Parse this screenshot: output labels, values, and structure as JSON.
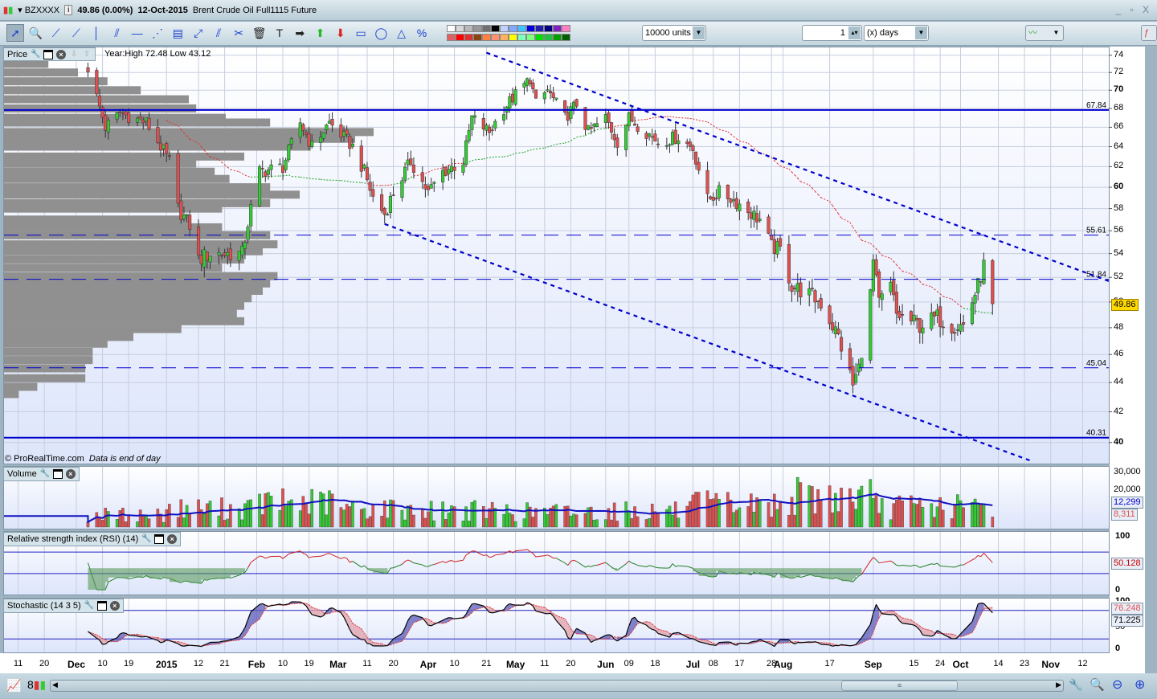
{
  "window": {
    "symbol": "BZXXXX",
    "quote": "49.86 (0.00%)",
    "date": "12-Oct-2015",
    "instrument": "Brent Crude Oil Full1115 Future",
    "controls": "_ ▫ X"
  },
  "toolbar": {
    "units": "10000 units",
    "period_value": "1",
    "period_unit": "(x) days",
    "tools": [
      "pointer-icon",
      "zoom-icon",
      "segment-icon",
      "line-icon",
      "vertical-line-icon",
      "channel-icon",
      "horizontal-line-icon",
      "fan-icon",
      "fibonacci-icon",
      "point-icon",
      "parallel-lines-icon",
      "tools-icon",
      "trash-icon",
      "text-icon",
      "arrow-right-icon",
      "arrow-up-icon",
      "arrow-down-icon",
      "rectangle-icon",
      "ellipse-icon",
      "triangle-icon",
      "percent-icon"
    ],
    "tool_glyphs": [
      "➚",
      "🔍",
      "⟋",
      "⟋",
      "│",
      "⫽",
      "—",
      "⋰",
      "▤",
      "⤢",
      "⫽",
      "✂",
      "🗑",
      "T",
      "➡",
      "⬆",
      "⬇",
      "▭",
      "◯",
      "△",
      "%"
    ],
    "palette_top": [
      "#ffffff",
      "#d8d8d8",
      "#b8b8b8",
      "#989898",
      "#707070",
      "#000000",
      "#c0d0ff",
      "#80a8ff",
      "#40c0ff",
      "#0000e0",
      "#2020b0",
      "#000080",
      "#8020c0",
      "#ff80c0"
    ],
    "palette_bottom": [
      "#e06060",
      "#ff0000",
      "#e03030",
      "#8b4513",
      "#ff8040",
      "#ff9070",
      "#ffb060",
      "#ffff00",
      "#80ffc0",
      "#80ff80",
      "#00e000",
      "#20c040",
      "#00a000",
      "#006000"
    ]
  },
  "price_panel": {
    "label": "Price",
    "year_range": "Year:High 72.48 Low 43.12",
    "copyright": "© ProRealTime.com",
    "data_note": "Data is end of day",
    "last_price": "49.86"
  },
  "volume_panel": {
    "label": "Volume",
    "ma_value": "12,299",
    "last_value": "8,311"
  },
  "rsi_panel": {
    "label": "Relative strength index (RSI) (14)",
    "value": "50.128"
  },
  "stoch_panel": {
    "label": "Stochastic (14 3 5)",
    "d_value": "76.248",
    "k_value": "71.225"
  },
  "colors": {
    "up": "#33cc33",
    "down": "#e05050",
    "level": "#0000cc",
    "ma_above": "#e03030",
    "ma_below": "#20a020",
    "last_price_bg": "#ffd800"
  },
  "chart_data": {
    "type": "candlestick",
    "title": "Brent Crude Oil Full1115 Future",
    "scale": "log",
    "ylim": [
      39,
      75
    ],
    "price_ticks": [
      40,
      42,
      44,
      46,
      48,
      50,
      52,
      54,
      56,
      58,
      60,
      62,
      64,
      66,
      68,
      70,
      72,
      74
    ],
    "bold_ticks": [
      40,
      60,
      70
    ],
    "key_closes": [
      [
        "2014-12-05",
        72.5
      ],
      [
        "2014-12-11",
        66
      ],
      [
        "2014-12-16",
        67.5
      ],
      [
        "2014-12-25",
        66.5
      ],
      [
        "2015-01-02",
        62.5
      ],
      [
        "2015-01-05",
        58
      ],
      [
        "2015-01-09",
        56.5
      ],
      [
        "2015-01-12",
        53.5
      ],
      [
        "2015-01-16",
        54
      ],
      [
        "2015-01-27",
        54
      ],
      [
        "2015-01-30",
        58
      ],
      [
        "2015-02-02",
        61.5
      ],
      [
        "2015-02-10",
        62
      ],
      [
        "2015-02-16",
        66.5
      ],
      [
        "2015-02-20",
        64
      ],
      [
        "2015-02-26",
        66.5
      ],
      [
        "2015-03-06",
        64
      ],
      [
        "2015-03-10",
        61.5
      ],
      [
        "2015-03-13",
        59
      ],
      [
        "2015-03-17",
        57.5
      ],
      [
        "2015-03-20",
        59.5
      ],
      [
        "2015-03-26",
        62.5
      ],
      [
        "2015-04-01",
        59.5
      ],
      [
        "2015-04-06",
        61.5
      ],
      [
        "2015-04-13",
        62.5
      ],
      [
        "2015-04-16",
        67
      ],
      [
        "2015-04-22",
        65.5
      ],
      [
        "2015-04-27",
        68
      ],
      [
        "2015-05-01",
        69.5
      ],
      [
        "2015-05-06",
        71.3
      ],
      [
        "2015-05-08",
        68.5
      ],
      [
        "2015-05-12",
        70
      ],
      [
        "2015-05-18",
        67
      ],
      [
        "2015-05-22",
        68.5
      ],
      [
        "2015-05-26",
        65.5
      ],
      [
        "2015-06-01",
        67
      ],
      [
        "2015-06-05",
        64.5
      ],
      [
        "2015-06-09",
        67
      ],
      [
        "2015-06-15",
        65.5
      ],
      [
        "2015-06-19",
        64.5
      ],
      [
        "2015-06-26",
        65
      ],
      [
        "2015-07-01",
        63.8
      ],
      [
        "2015-07-06",
        58.8
      ],
      [
        "2015-07-10",
        59.5
      ],
      [
        "2015-07-14",
        59
      ],
      [
        "2015-07-17",
        58.4
      ],
      [
        "2015-07-24",
        57
      ],
      [
        "2015-07-28",
        54.6
      ],
      [
        "2015-07-31",
        54.3
      ],
      [
        "2015-08-04",
        51.3
      ],
      [
        "2015-08-10",
        50.6
      ],
      [
        "2015-08-14",
        49.9
      ],
      [
        "2015-08-20",
        47.3
      ],
      [
        "2015-08-25",
        43.8
      ],
      [
        "2015-08-27",
        45
      ],
      [
        "2015-08-31",
        50.6
      ],
      [
        "2015-09-01",
        53.3
      ],
      [
        "2015-09-03",
        49.9
      ],
      [
        "2015-09-07",
        51.3
      ],
      [
        "2015-09-09",
        49
      ],
      [
        "2015-09-14",
        48.5
      ],
      [
        "2015-09-17",
        48.2
      ],
      [
        "2015-09-23",
        48.8
      ],
      [
        "2015-09-28",
        48.2
      ],
      [
        "2015-10-02",
        48.2
      ],
      [
        "2015-10-07",
        51.3
      ],
      [
        "2015-10-09",
        53
      ],
      [
        "2015-10-12",
        49.86
      ]
    ],
    "levels": [
      {
        "value": 67.84,
        "label": "67.84",
        "style": "solid"
      },
      {
        "value": 55.61,
        "label": "55.61",
        "style": "dashed"
      },
      {
        "value": 51.84,
        "label": "51.84",
        "style": "dashed"
      },
      {
        "value": 45.04,
        "label": "45.04",
        "style": "dashed"
      },
      {
        "value": 40.31,
        "label": "40.31",
        "style": "solid"
      }
    ],
    "trendlines": [
      {
        "from": [
          "2015-04-21",
          74.3
        ],
        "to": [
          "2015-11-22",
          51.6
        ]
      },
      {
        "from": [
          "2015-03-17",
          56.6
        ],
        "to": [
          "2015-10-26",
          38.8
        ]
      }
    ],
    "moving_average_period": 50,
    "volume_profile": [
      [
        74,
        0.05
      ],
      [
        73,
        0.12
      ],
      [
        72,
        0.2
      ],
      [
        71,
        0.28
      ],
      [
        70,
        0.37
      ],
      [
        69,
        0.5
      ],
      [
        68,
        0.52
      ],
      [
        67,
        0.6
      ],
      [
        66.5,
        0.72
      ],
      [
        65.5,
        1.0
      ],
      [
        64.8,
        0.95
      ],
      [
        64,
        0.83
      ],
      [
        63,
        0.65
      ],
      [
        62.3,
        0.52
      ],
      [
        61.5,
        0.57
      ],
      [
        60.8,
        0.61
      ],
      [
        60,
        0.72
      ],
      [
        59.3,
        0.8
      ],
      [
        58.5,
        0.72
      ],
      [
        58,
        0.59
      ],
      [
        57,
        0.5
      ],
      [
        56.3,
        0.59
      ],
      [
        55.6,
        0.72
      ],
      [
        54.8,
        0.74
      ],
      [
        54.2,
        0.7
      ],
      [
        53.5,
        0.65
      ],
      [
        52.8,
        0.59
      ],
      [
        52.1,
        0.74
      ],
      [
        51.5,
        0.72
      ],
      [
        50.9,
        0.7
      ],
      [
        50.3,
        0.67
      ],
      [
        49.7,
        0.65
      ],
      [
        49.1,
        0.63
      ],
      [
        48.5,
        0.65
      ],
      [
        47.9,
        0.48
      ],
      [
        47.3,
        0.35
      ],
      [
        46.8,
        0.28
      ],
      [
        46.2,
        0.24
      ],
      [
        45.6,
        0.24
      ],
      [
        45,
        0.22
      ],
      [
        44.3,
        0.22
      ],
      [
        43.7,
        0.09
      ],
      [
        43.2,
        0.04
      ]
    ],
    "volume_monthly_avg": {
      "2014-12": 6000,
      "2015-01": 9000,
      "2015-02": 12000,
      "2015-03": 9000,
      "2015-04": 8000,
      "2015-05": 7500,
      "2015-06": 8000,
      "2015-07": 11000,
      "2015-08": 15000,
      "2015-09": 10000,
      "2015-10": 10000
    },
    "volume_ticks": [
      "30,000",
      "20,000"
    ],
    "rsi_ticks": [
      "100",
      "0"
    ],
    "stoch_ticks": [
      "100",
      "50",
      "0"
    ],
    "x_labels": [
      [
        "2014-11-11",
        "11",
        0
      ],
      [
        "2014-11-20",
        "20",
        0
      ],
      [
        "2014-12-01",
        "Dec",
        1
      ],
      [
        "2014-12-10",
        "10",
        0
      ],
      [
        "2014-12-19",
        "19",
        0
      ],
      [
        "2015-01-01",
        "2015",
        1
      ],
      [
        "2015-01-12",
        "12",
        0
      ],
      [
        "2015-01-21",
        "21",
        0
      ],
      [
        "2015-02-01",
        "Feb",
        1
      ],
      [
        "2015-02-10",
        "10",
        0
      ],
      [
        "2015-02-19",
        "19",
        0
      ],
      [
        "2015-03-01",
        "Mar",
        1
      ],
      [
        "2015-03-11",
        "11",
        0
      ],
      [
        "2015-03-20",
        "20",
        0
      ],
      [
        "2015-04-01",
        "Apr",
        1
      ],
      [
        "2015-04-10",
        "10",
        0
      ],
      [
        "2015-04-21",
        "21",
        0
      ],
      [
        "2015-05-01",
        "May",
        1
      ],
      [
        "2015-05-11",
        "11",
        0
      ],
      [
        "2015-05-20",
        "20",
        0
      ],
      [
        "2015-06-01",
        "Jun",
        1
      ],
      [
        "2015-06-09",
        "09",
        0
      ],
      [
        "2015-06-18",
        "18",
        0
      ],
      [
        "2015-07-01",
        "Jul",
        1
      ],
      [
        "2015-07-08",
        "08",
        0
      ],
      [
        "2015-07-17",
        "17",
        0
      ],
      [
        "2015-07-28",
        "28",
        0
      ],
      [
        "2015-08-01",
        "Aug",
        1
      ],
      [
        "2015-08-17",
        "17",
        0
      ],
      [
        "2015-09-01",
        "Sep",
        1
      ],
      [
        "2015-09-15",
        "15",
        0
      ],
      [
        "2015-09-24",
        "24",
        0
      ],
      [
        "2015-10-01",
        "Oct",
        1
      ],
      [
        "2015-10-14",
        "14",
        0
      ],
      [
        "2015-10-23",
        "23",
        0
      ],
      [
        "2015-11-01",
        "Nov",
        1
      ],
      [
        "2015-11-12",
        "12",
        0
      ]
    ]
  }
}
